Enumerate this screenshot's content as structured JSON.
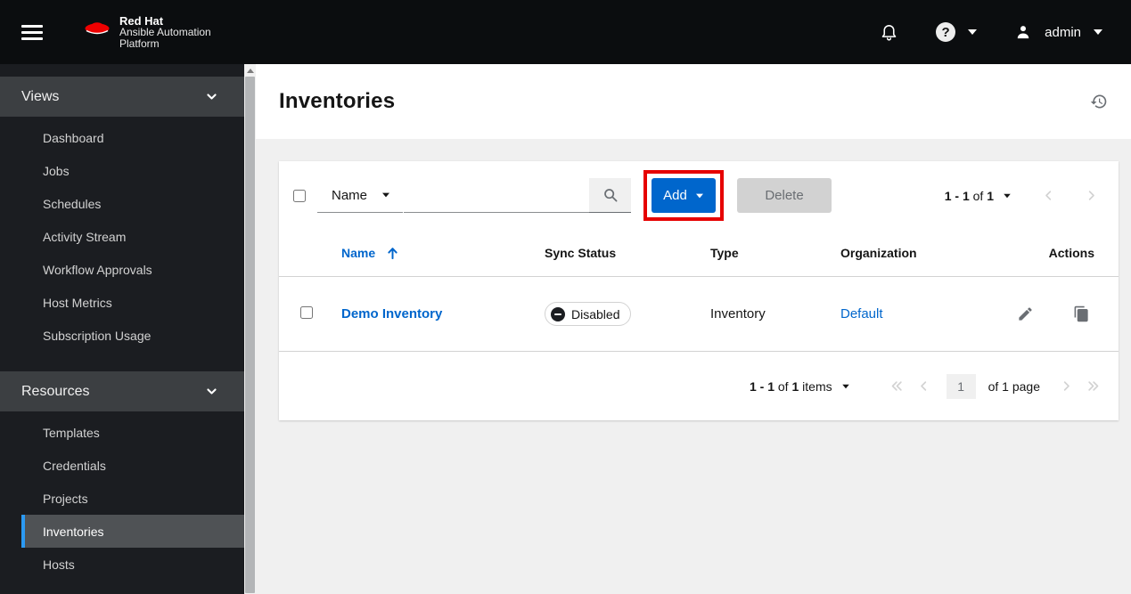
{
  "masthead": {
    "brand": {
      "name": "Red Hat",
      "product_line1": "Ansible Automation",
      "product_line2": "Platform"
    },
    "user_name": "admin"
  },
  "sidebar": {
    "sections": [
      {
        "label": "Views",
        "items": [
          "Dashboard",
          "Jobs",
          "Schedules",
          "Activity Stream",
          "Workflow Approvals",
          "Host Metrics",
          "Subscription Usage"
        ]
      },
      {
        "label": "Resources",
        "items": [
          "Templates",
          "Credentials",
          "Projects",
          "Inventories",
          "Hosts"
        ],
        "active_item": "Inventories"
      }
    ]
  },
  "page": {
    "title": "Inventories"
  },
  "toolbar": {
    "filter": {
      "selected": "Name"
    },
    "search": {
      "value": "",
      "placeholder": ""
    },
    "add_label": "Add",
    "delete_label": "Delete",
    "pagination": {
      "range": "1 - 1",
      "of_word": "of",
      "total": "1"
    }
  },
  "table": {
    "columns": [
      "Name",
      "Sync Status",
      "Type",
      "Organization",
      "Actions"
    ],
    "rows": [
      {
        "name": "Demo Inventory",
        "sync_status": "Disabled",
        "type": "Inventory",
        "organization": "Default"
      }
    ]
  },
  "bottom_pagination": {
    "range": "1 - 1",
    "of_word": "of",
    "total": "1",
    "items_word": "items",
    "current_page": "1",
    "page_of": "of 1 page"
  },
  "colors": {
    "brand_red": "#ee0000",
    "accent_blue": "#0066cc",
    "annotation_red": "#e60000",
    "nav_active_indicator": "#2b9af3",
    "status_badge_icon": "#1b1d21",
    "disabled_gray": "#d2d2d2"
  }
}
